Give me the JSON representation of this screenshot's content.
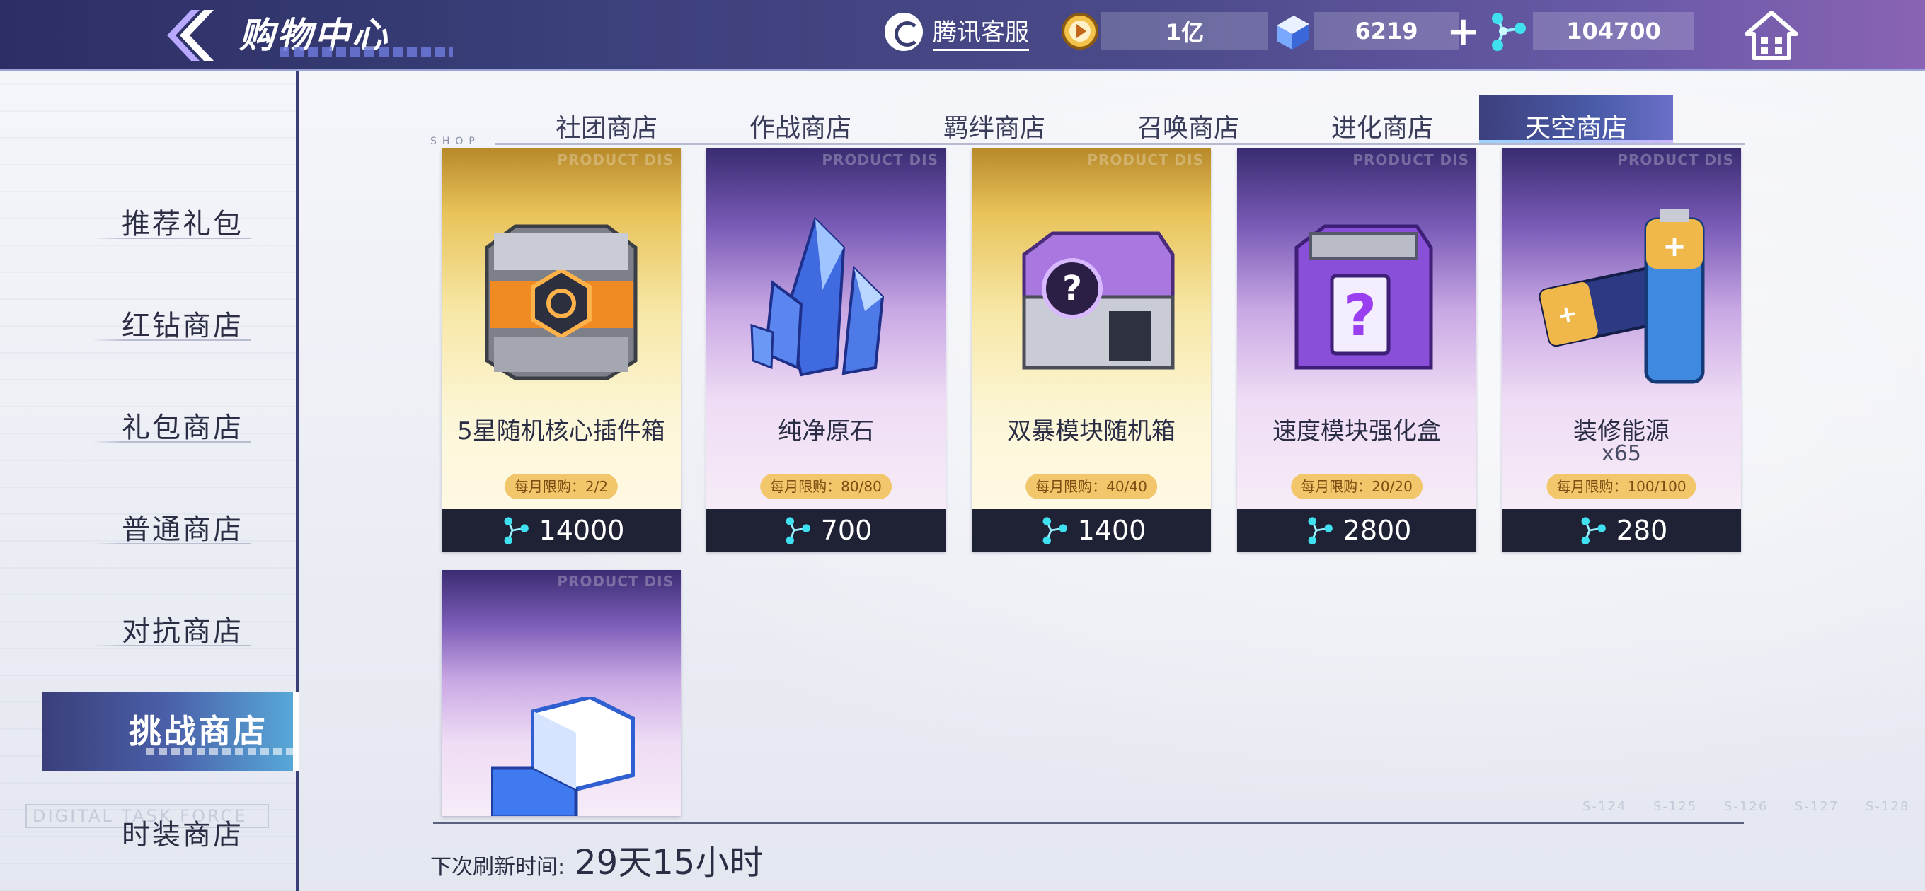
{
  "header": {
    "title": "购物中心",
    "service_label": "腾讯客服",
    "currencies": [
      {
        "icon": "coin-icon",
        "value": "1亿"
      },
      {
        "icon": "cube-gem-icon",
        "value": "6219"
      },
      {
        "icon": "sky-crystal-icon",
        "value": "104700"
      }
    ]
  },
  "sidebar": {
    "items": [
      {
        "label": "推荐礼包"
      },
      {
        "label": "红钻商店"
      },
      {
        "label": "礼包商店"
      },
      {
        "label": "普通商店"
      },
      {
        "label": "对抗商店"
      },
      {
        "label": "挑战商店",
        "active": true
      },
      {
        "label": "时装商店"
      }
    ],
    "watermark": "DIGITAL TASK FORCE"
  },
  "tabs": [
    {
      "label": "社团商店"
    },
    {
      "label": "作战商店"
    },
    {
      "label": "羁绊商店"
    },
    {
      "label": "召唤商店"
    },
    {
      "label": "进化商店"
    },
    {
      "label": "天空商店",
      "active": true
    }
  ],
  "shop_label": "SHOP",
  "products": [
    {
      "name": "5星随机核心插件箱",
      "qty": "",
      "limit": "每月限购：2/2",
      "price": "14000",
      "bg": "gold",
      "icon": "core-plugin-box-icon"
    },
    {
      "name": "纯净原石",
      "qty": "",
      "limit": "每月限购：80/80",
      "price": "700",
      "bg": "purple",
      "icon": "crystal-icon"
    },
    {
      "name": "双暴模块随机箱",
      "qty": "",
      "limit": "每月限购：40/40",
      "price": "1400",
      "bg": "gold",
      "icon": "mystery-chest-icon"
    },
    {
      "name": "速度模块强化盒",
      "qty": "",
      "limit": "每月限购：20/20",
      "price": "2800",
      "bg": "purple",
      "icon": "mystery-box-icon"
    },
    {
      "name": "装修能源",
      "qty": "x65",
      "limit": "每月限购：100/100",
      "price": "280",
      "bg": "purple",
      "icon": "battery-icon"
    },
    {
      "name": "",
      "qty": "",
      "limit": "",
      "price": "",
      "bg": "purple",
      "icon": "cube-block-icon"
    }
  ],
  "product_watermark": "PRODUCT DIS",
  "refresh": {
    "label": "下次刷新时间:",
    "value": "29天15小时"
  },
  "corner_coords": "S-124 S-125 S-126 S-127 S-128"
}
